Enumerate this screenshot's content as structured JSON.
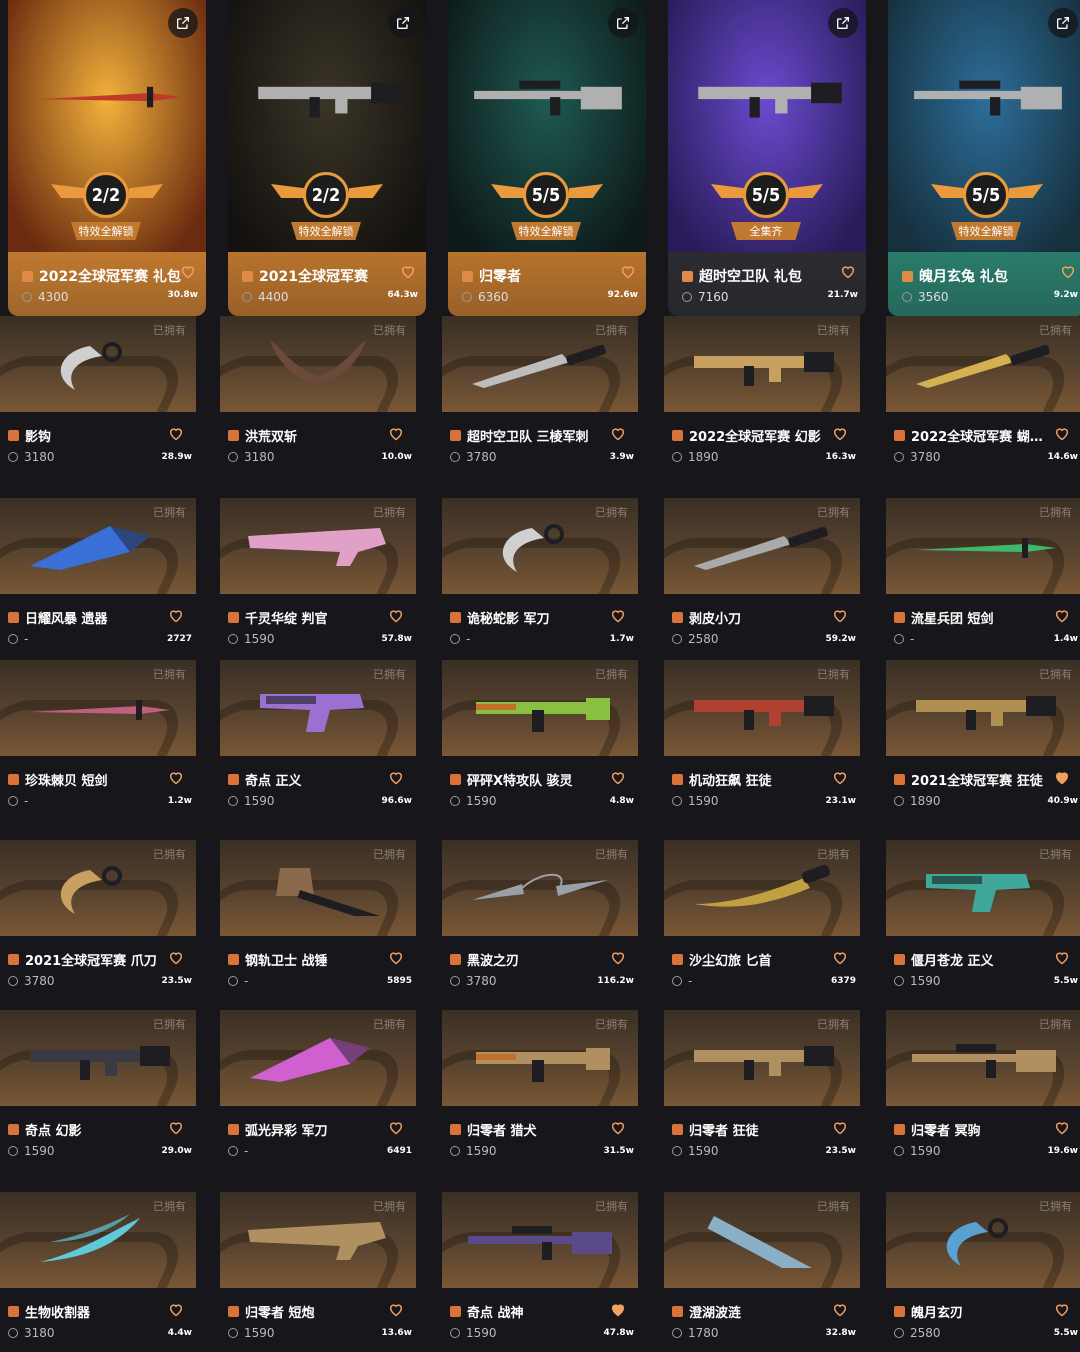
{
  "bundles": [
    {
      "name": "2022全球冠军赛 礼包",
      "price": "4300",
      "likes": "30.8w",
      "badge": "2/2",
      "strip": "特效全解锁",
      "theme": "#c0792f",
      "art_a": "#f2b23b",
      "art_b": "#6b2b10"
    },
    {
      "name": "2021全球冠军赛",
      "price": "4400",
      "likes": "64.3w",
      "badge": "2/2",
      "strip": "特效全解锁",
      "theme": "#b8732c",
      "art_a": "#3b3527",
      "art_b": "#141210"
    },
    {
      "name": "归零者",
      "price": "6360",
      "likes": "92.6w",
      "badge": "5/5",
      "strip": "特效全解锁",
      "theme": "#b8732c",
      "art_a": "#1f5a52",
      "art_b": "#0d1a1a"
    },
    {
      "name": "超时空卫队 礼包",
      "price": "7160",
      "likes": "21.7w",
      "badge": "5/5",
      "strip": "全集齐",
      "theme": "#2b2b32",
      "art_a": "#6a4bd0",
      "art_b": "#2a1c5a"
    },
    {
      "name": "魄月玄兔 礼包",
      "price": "3560",
      "likes": "9.2w",
      "badge": "5/5",
      "strip": "特效全解锁",
      "theme": "#2a7c6a",
      "art_a": "#2d6e9a",
      "art_b": "#16303e"
    }
  ],
  "owned_label": "已拥有",
  "rows": [
    [
      {
        "name": "影钩",
        "price": "3180",
        "likes": "28.9w",
        "tier": "#d9733a",
        "liked": false,
        "shape": "karambit",
        "color": "#cfcfcf"
      },
      {
        "name": "洪荒双斩",
        "price": "3180",
        "likes": "10.0w",
        "tier": "#d9733a",
        "liked": false,
        "shape": "wings",
        "color": "#6b4a3a"
      },
      {
        "name": "超时空卫队 三棱军刺",
        "price": "3780",
        "likes": "3.9w",
        "tier": "#d9733a",
        "liked": false,
        "shape": "knife",
        "color": "#bdbdbd"
      },
      {
        "name": "2022全球冠军赛 幻影",
        "price": "1890",
        "likes": "16.3w",
        "tier": "#d9733a",
        "liked": false,
        "shape": "rifle",
        "color": "#c8a060"
      },
      {
        "name": "2022全球冠军赛 蝴…",
        "price": "3780",
        "likes": "14.6w",
        "tier": "#d9733a",
        "liked": false,
        "shape": "knife",
        "color": "#d4b050"
      }
    ],
    [
      {
        "name": "日耀风暴 遗器",
        "price": "-",
        "likes": "2727",
        "tier": "#d9733a",
        "liked": false,
        "shape": "blade",
        "color": "#3a6fd8"
      },
      {
        "name": "千灵华绽 判官",
        "price": "1590",
        "likes": "57.8w",
        "tier": "#d9733a",
        "liked": false,
        "shape": "shotgun",
        "color": "#e0a0c8"
      },
      {
        "name": "诡秘蛇影 军刀",
        "price": "-",
        "likes": "1.7w",
        "tier": "#d9733a",
        "liked": false,
        "shape": "karambit",
        "color": "#d0d0d0"
      },
      {
        "name": "剥皮小刀",
        "price": "2580",
        "likes": "59.2w",
        "tier": "#d9733a",
        "liked": false,
        "shape": "knife",
        "color": "#aaaaaa"
      },
      {
        "name": "流星兵团 短剑",
        "price": "-",
        "likes": "1.4w",
        "tier": "#d9733a",
        "liked": false,
        "shape": "sword",
        "color": "#3fb86a"
      }
    ],
    [
      {
        "name": "珍珠棘贝 短剑",
        "price": "-",
        "likes": "1.2w",
        "tier": "#d9733a",
        "liked": false,
        "shape": "sword",
        "color": "#c06080"
      },
      {
        "name": "奇点 正义",
        "price": "1590",
        "likes": "96.6w",
        "tier": "#d9733a",
        "liked": false,
        "shape": "pistol",
        "color": "#9a70d0"
      },
      {
        "name": "砰砰X特攻队 骇灵",
        "price": "1590",
        "likes": "4.8w",
        "tier": "#d9733a",
        "liked": false,
        "shape": "smg",
        "color": "#8ac040"
      },
      {
        "name": "机动狂飙 狂徒",
        "price": "1590",
        "likes": "23.1w",
        "tier": "#d9733a",
        "liked": false,
        "shape": "rifle",
        "color": "#b04030"
      },
      {
        "name": "2021全球冠军赛 狂徒",
        "price": "1890",
        "likes": "40.9w",
        "tier": "#d9733a",
        "liked": true,
        "shape": "rifle",
        "color": "#b09050"
      }
    ],
    [
      {
        "name": "2021全球冠军赛 爪刀",
        "price": "3780",
        "likes": "23.5w",
        "tier": "#d9733a",
        "liked": false,
        "shape": "karambit",
        "color": "#c8a060"
      },
      {
        "name": "钢轨卫士 战锤",
        "price": "-",
        "likes": "5895",
        "tier": "#d9733a",
        "liked": false,
        "shape": "axe",
        "color": "#8a6a4a"
      },
      {
        "name": "黑波之刃",
        "price": "3780",
        "likes": "116.2w",
        "tier": "#d9733a",
        "liked": false,
        "shape": "kunai",
        "color": "#9aa0a8"
      },
      {
        "name": "沙尘幻旅 匕首",
        "price": "-",
        "likes": "6379",
        "tier": "#d9733a",
        "liked": false,
        "shape": "dagger",
        "color": "#c0a040"
      },
      {
        "name": "偃月苍龙 正义",
        "price": "1590",
        "likes": "5.5w",
        "tier": "#d9733a",
        "liked": false,
        "shape": "pistol",
        "color": "#3fa89a"
      }
    ],
    [
      {
        "name": "奇点 幻影",
        "price": "1590",
        "likes": "29.0w",
        "tier": "#d9733a",
        "liked": false,
        "shape": "rifle",
        "color": "#3a3a44"
      },
      {
        "name": "弧光异彩 军刀",
        "price": "-",
        "likes": "6491",
        "tier": "#d9733a",
        "liked": false,
        "shape": "blade",
        "color": "#d060d0"
      },
      {
        "name": "归零者 猎犬",
        "price": "1590",
        "likes": "31.5w",
        "tier": "#d9733a",
        "liked": false,
        "shape": "smg",
        "color": "#b09060"
      },
      {
        "name": "归零者 狂徒",
        "price": "1590",
        "likes": "23.5w",
        "tier": "#d9733a",
        "liked": false,
        "shape": "rifle",
        "color": "#b09060"
      },
      {
        "name": "归零者 冥驹",
        "price": "1590",
        "likes": "19.6w",
        "tier": "#d9733a",
        "liked": false,
        "shape": "sniper",
        "color": "#b09060"
      }
    ],
    [
      {
        "name": "生物收割器",
        "price": "3180",
        "likes": "4.4w",
        "tier": "#d9733a",
        "liked": false,
        "shape": "claw",
        "color": "#60c8d8"
      },
      {
        "name": "归零者 短炮",
        "price": "1590",
        "likes": "13.6w",
        "tier": "#d9733a",
        "liked": false,
        "shape": "shotgun",
        "color": "#b09060"
      },
      {
        "name": "奇点 战神",
        "price": "1590",
        "likes": "47.8w",
        "tier": "#d9733a",
        "liked": true,
        "shape": "sniper",
        "color": "#5a4a8a"
      },
      {
        "name": "澄湖波涟",
        "price": "1780",
        "likes": "32.8w",
        "tier": "#d9733a",
        "liked": false,
        "shape": "fan",
        "color": "#8ab0c8"
      },
      {
        "name": "魄月玄刃",
        "price": "2580",
        "likes": "5.5w",
        "tier": "#d9733a",
        "liked": false,
        "shape": "karambit",
        "color": "#5aa0d0"
      }
    ]
  ]
}
